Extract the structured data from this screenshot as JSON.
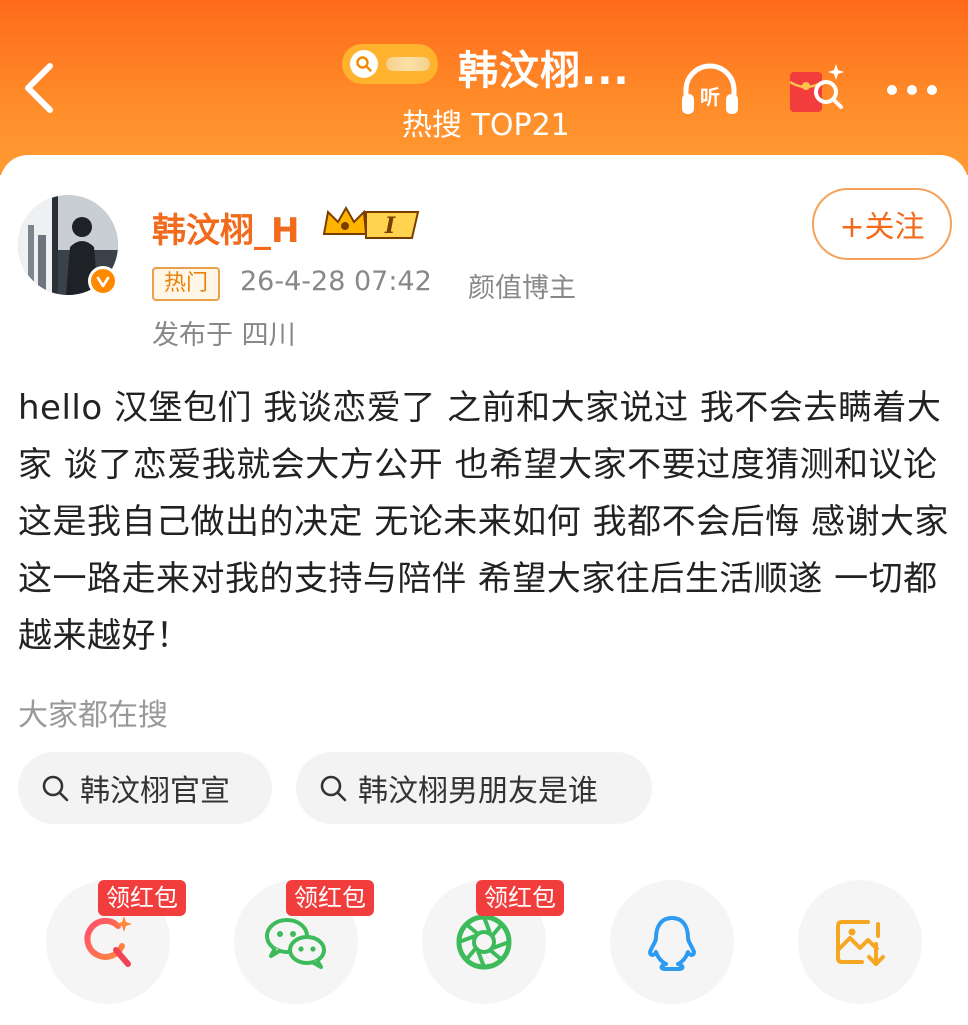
{
  "header": {
    "back_icon": "chevron-left-icon",
    "title": "韩汶栩...",
    "subtitle": "热搜 TOP21",
    "listen_label": "听",
    "listen_icon": "headphones-icon",
    "redpack_icon": "red-envelope-search-icon",
    "more_icon": "more-dots-icon",
    "background": "#ff7a22"
  },
  "post": {
    "username": "韩汶栩_H",
    "level_badge": "I",
    "hot_tag": "热门",
    "timestamp": "26-4-28 07:42",
    "category": "颜值博主",
    "location": "发布于 四川",
    "follow_label": "+关注",
    "content": "hello 汉堡包们 我谈恋爱了 之前和大家说过 我不会去瞒着大家 谈了恋爱我就会大方公开 也希望大家不要过度猜测和议论 这是我自己做出的决定 无论未来如何 我都不会后悔 感谢大家这一路走来对我的支持与陪伴 希望大家往后生活顺遂 一切都越来越好！"
  },
  "related_search": {
    "label": "大家都在搜",
    "chips": [
      "韩汶栩官宣",
      "韩汶栩男朋友是谁"
    ]
  },
  "share": {
    "badge_label": "领红包",
    "items": [
      {
        "icon": "weibo-search-icon",
        "color": "#ee4455"
      },
      {
        "icon": "wechat-icon",
        "color": "#3dbb5a"
      },
      {
        "icon": "moments-icon",
        "color": "#3dbb5a"
      },
      {
        "icon": "qq-icon",
        "color": "#2d9cf0"
      },
      {
        "icon": "save-image-icon",
        "color": "#f5a623"
      }
    ]
  },
  "colors": {
    "accent": "#f26a1b",
    "badge_red": "#f23d3d"
  }
}
